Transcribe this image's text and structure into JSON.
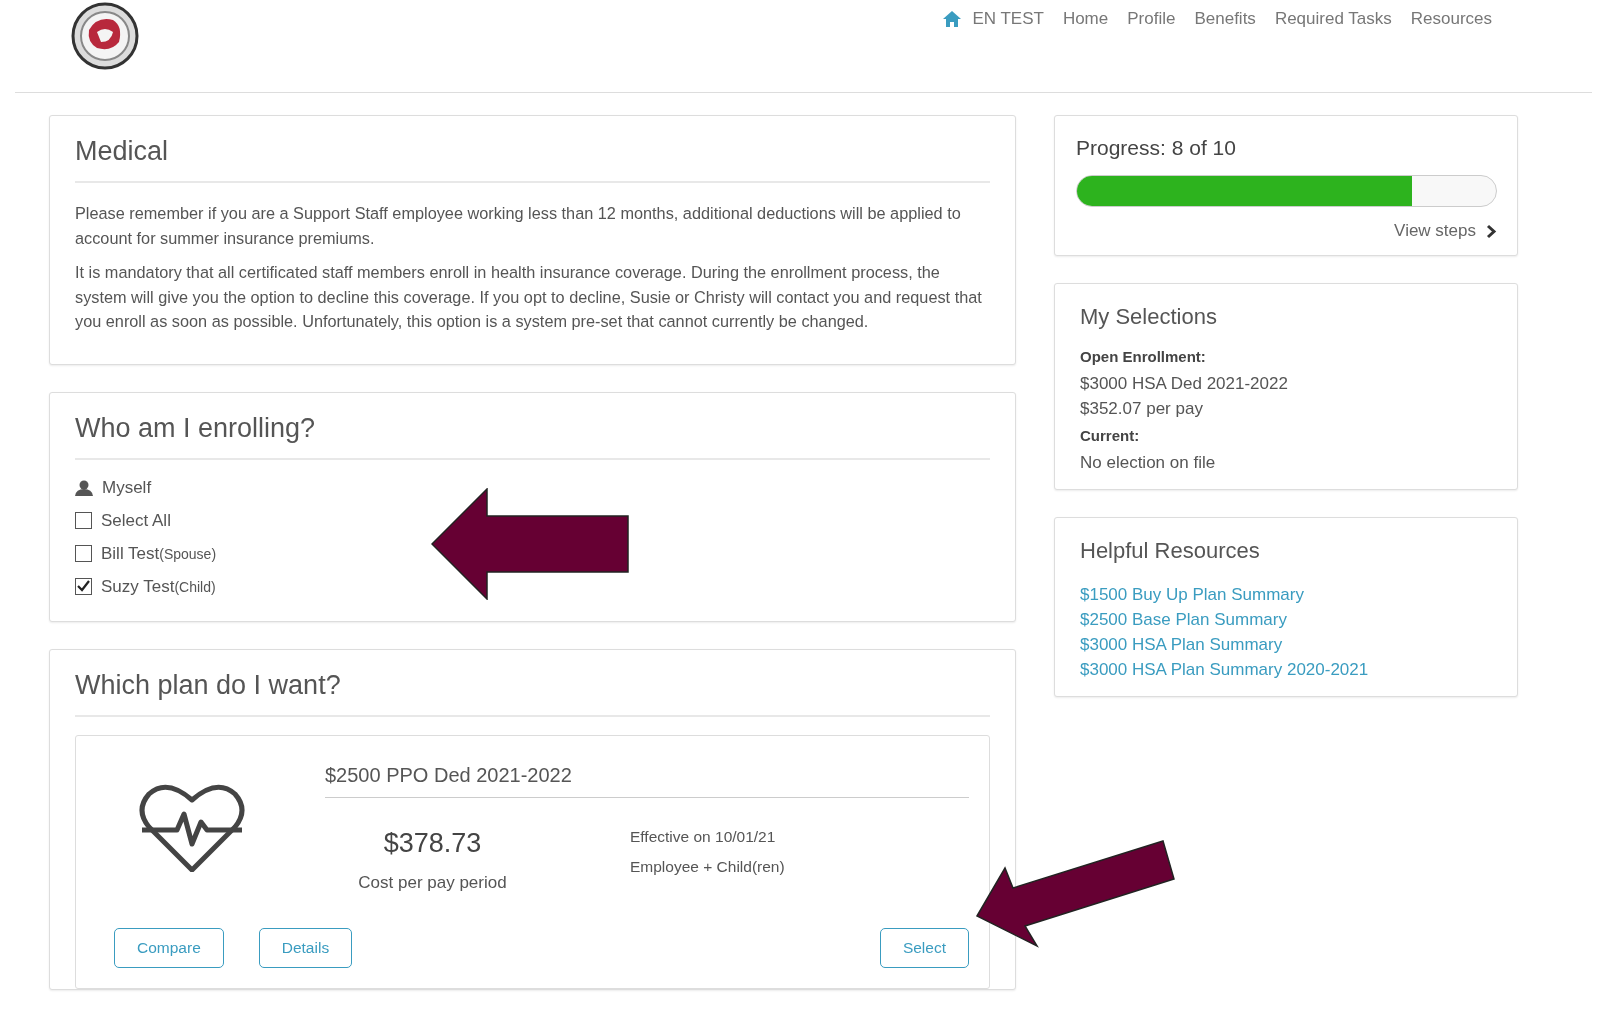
{
  "nav": {
    "items": [
      {
        "label": "EN TEST",
        "kind": "home"
      },
      {
        "label": "Home",
        "kind": "link"
      },
      {
        "label": "Profile",
        "kind": "link"
      },
      {
        "label": "Benefits",
        "kind": "link"
      },
      {
        "label": "Required Tasks",
        "kind": "link"
      },
      {
        "label": "Resources",
        "kind": "link"
      }
    ]
  },
  "medical": {
    "title": "Medical",
    "paragraphs": [
      "Please remember if you are a Support Staff employee working less than 12 months, additional deductions will be applied to account for summer insurance premiums.",
      "It is mandatory that all certificated staff members enroll in health insurance coverage.  During the enrollment process, the system will give you the option to decline this coverage.  If you opt to decline, Susie or Christy will contact you and request that you enroll as soon as possible.  Unfortunately, this option is a system pre-set that cannot currently be changed."
    ]
  },
  "enrolling": {
    "title": "Who am I enrolling?",
    "members": [
      {
        "kind": "person",
        "name": "Myself"
      },
      {
        "kind": "checkbox",
        "name": "Select All",
        "checked": false
      },
      {
        "kind": "checkbox",
        "name": "Bill Test",
        "relation": "(Spouse)",
        "checked": false
      },
      {
        "kind": "checkbox",
        "name": "Suzy Test",
        "relation": "(Child)",
        "checked": true
      }
    ]
  },
  "plan": {
    "title": "Which plan do I want?",
    "name": "$2500 PPO Ded 2021-2022",
    "price": "$378.73",
    "price_label": "Cost per pay period",
    "effective": "Effective on 10/01/21",
    "coverage": "Employee + Child(ren)",
    "buttons": [
      "Compare",
      "Details"
    ],
    "select_button": "Select"
  },
  "progress": {
    "label": "Progress: 8 of 10",
    "level": 0.8,
    "link": "View steps"
  },
  "selections": {
    "title": "My Selections",
    "groups": [
      {
        "heading": "Open Enrollment:",
        "lines": [
          "$3000 HSA Ded 2021-2022",
          "$352.07 per pay"
        ]
      },
      {
        "heading": "Current:",
        "lines": [
          "No election on file"
        ]
      }
    ]
  },
  "resources": {
    "title": "Helpful Resources",
    "links": [
      "$1500 Buy Up Plan Summary",
      "$2500 Base Plan Summary",
      "$3000 HSA Plan Summary",
      "$3000 HSA Plan Summary 2020-2021"
    ]
  }
}
